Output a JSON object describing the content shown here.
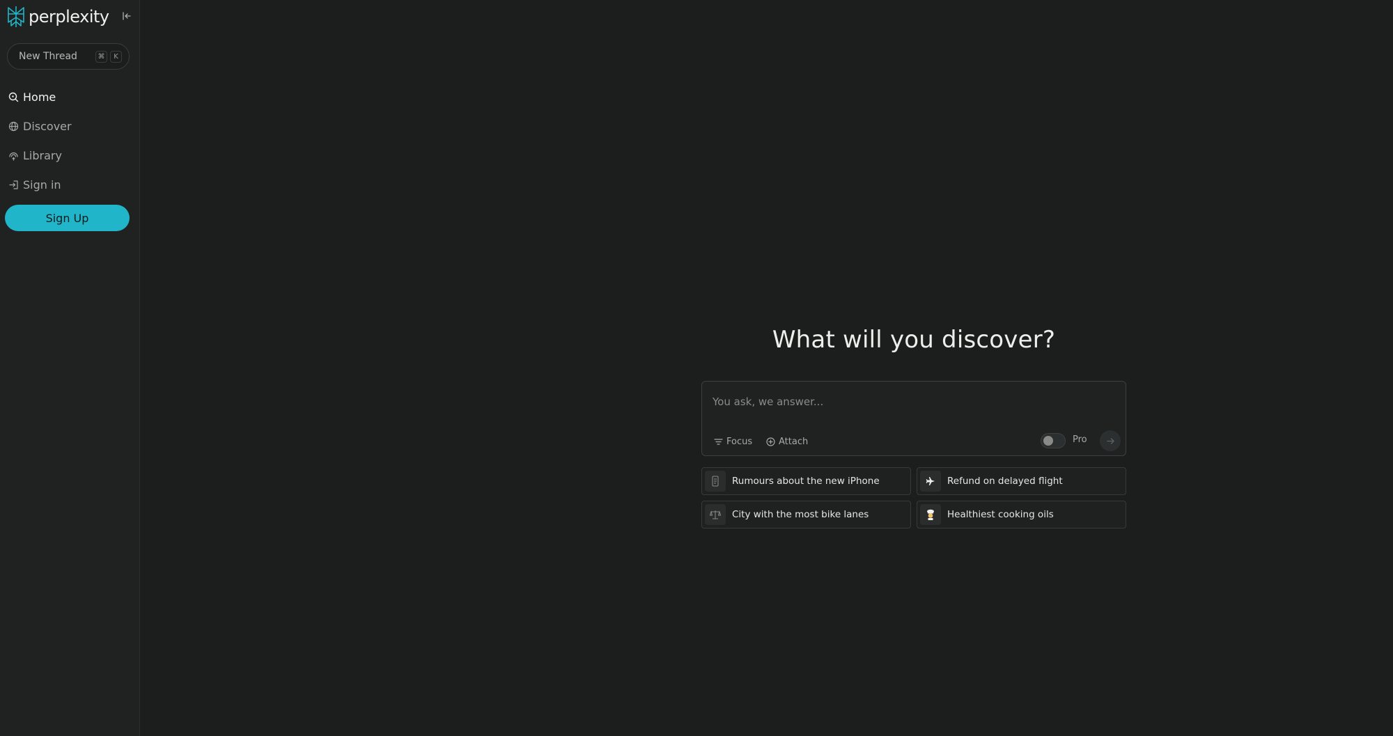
{
  "sidebar": {
    "logo_text": "perplexity",
    "new_thread": {
      "label": "New Thread",
      "shortcut": [
        "⌘",
        "K"
      ]
    },
    "nav": [
      {
        "label": "Home",
        "icon": "home-search-icon",
        "active": true
      },
      {
        "label": "Discover",
        "icon": "globe-icon",
        "active": false
      },
      {
        "label": "Library",
        "icon": "library-icon",
        "active": false
      },
      {
        "label": "Sign in",
        "icon": "sign-in-icon",
        "active": false
      }
    ],
    "signup_label": "Sign Up"
  },
  "main": {
    "headline": "What will you discover?",
    "ask": {
      "placeholder": "You ask, we answer...",
      "value": "",
      "focus_label": "Focus",
      "attach_label": "Attach",
      "pro_label": "Pro",
      "pro_enabled": false
    },
    "suggestions": [
      {
        "label": "Rumours about the new iPhone",
        "icon": "phone-icon"
      },
      {
        "label": "Refund on delayed flight",
        "icon": "airplane-icon",
        "emoji": "✈"
      },
      {
        "label": "City with the most bike lanes",
        "icon": "scales-icon"
      },
      {
        "label": "Healthiest cooking oils",
        "icon": "chef-icon",
        "emoji": "👨‍🍳"
      }
    ]
  },
  "colors": {
    "accent": "#21b5c9",
    "background": "#1c1d1d",
    "sidebar": "#202222"
  }
}
